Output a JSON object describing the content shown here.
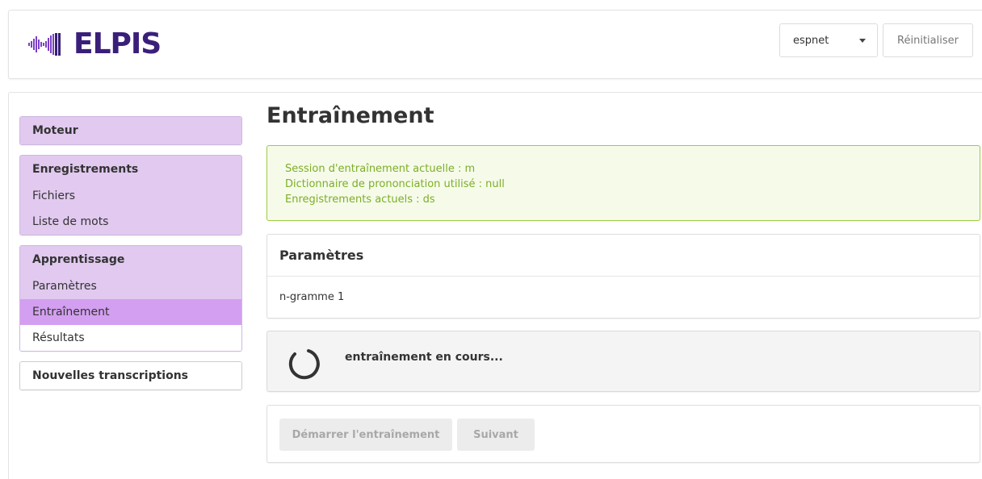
{
  "header": {
    "logo_text": "ELPIS",
    "engine_select_value": "espnet",
    "reset_label": "Réinitialiser"
  },
  "sidebar": {
    "engine": {
      "heading": "Moteur"
    },
    "recordings": {
      "heading": "Enregistrements",
      "items": [
        "Fichiers",
        "Liste de mots"
      ]
    },
    "learning": {
      "heading": "Apprentissage",
      "items": [
        "Paramètres",
        "Entraînement",
        "Résultats"
      ]
    },
    "new_transcriptions": {
      "heading": "Nouvelles transcriptions"
    }
  },
  "main": {
    "title": "Entraînement",
    "alert_lines": [
      "Session d'entraînement actuelle : m",
      "Dictionnaire de prononciation utilisé : null",
      "Enregistrements actuels : ds"
    ],
    "params": {
      "heading": "Paramètres",
      "value": "n-gramme 1"
    },
    "status_text": "entraînement en cours...",
    "start_label": "Démarrer l'entraînement",
    "next_label": "Suivant"
  },
  "colors": {
    "brand": "#3a1f7a",
    "nav_bg": "#e1c9ef",
    "nav_active": "#d39ff0",
    "alert_text": "#7cae28",
    "alert_border": "#9ccb42"
  }
}
